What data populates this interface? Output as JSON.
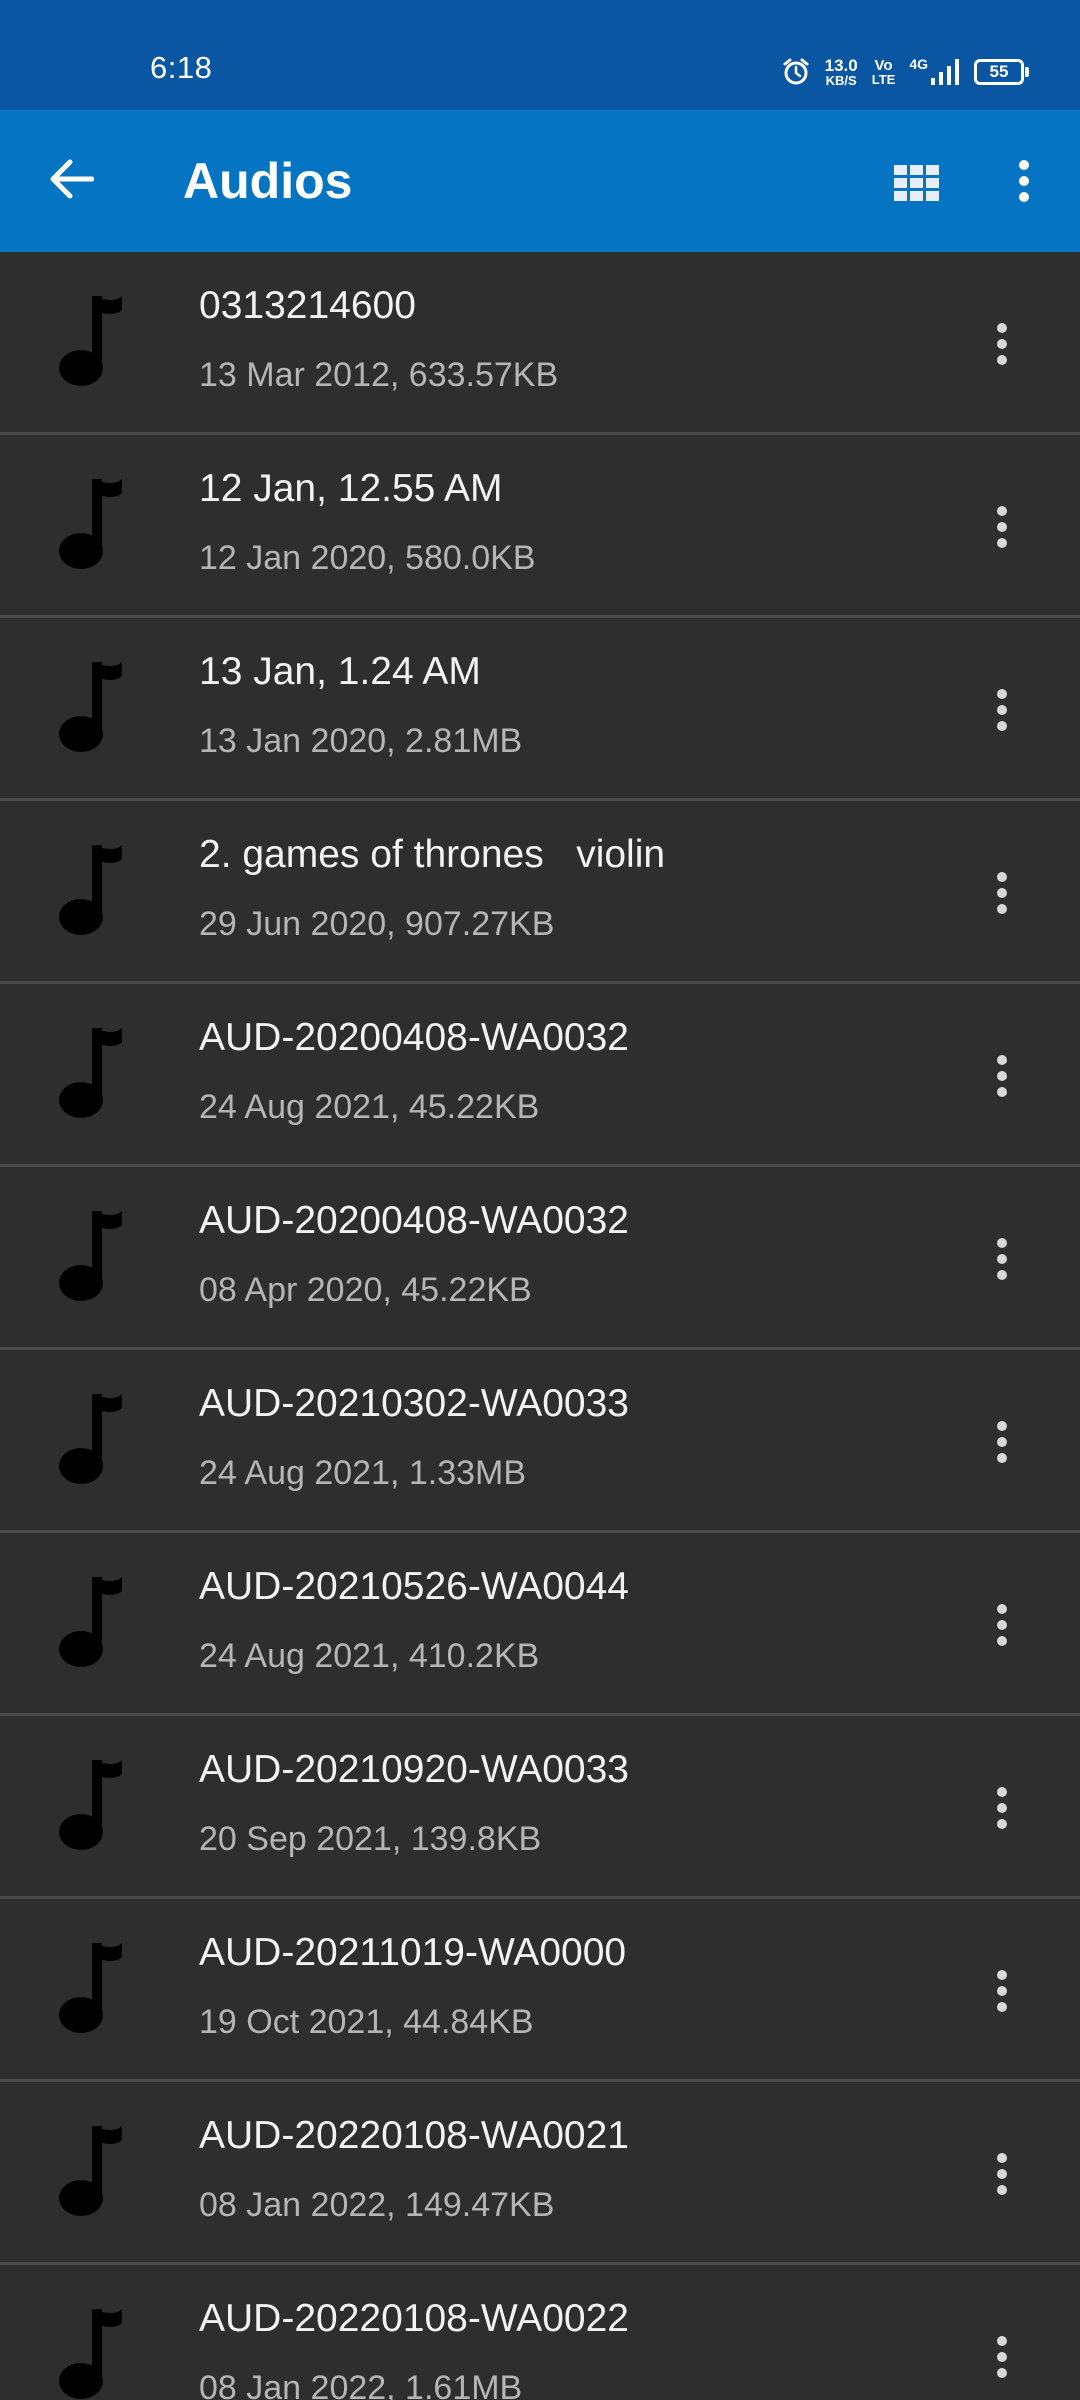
{
  "status_bar": {
    "time": "6:18",
    "net_speed_value": "13.0",
    "net_speed_unit": "KB/S",
    "volte_top": "Vo",
    "volte_bottom": "LTE",
    "network_type": "4G",
    "battery_level": "55",
    "icons": [
      "alarm-icon",
      "signal-icon",
      "battery-icon"
    ]
  },
  "app_bar": {
    "title": "Audios",
    "icons": [
      "back-arrow-icon",
      "grid-view-icon",
      "more-vert-icon"
    ],
    "background_color": "#0574c2"
  },
  "files": [
    {
      "name": "0313214600",
      "meta": "13 Mar 2012, 633.57KB"
    },
    {
      "name": "12 Jan, 12.55 AM",
      "meta": "12 Jan 2020, 580.0KB"
    },
    {
      "name": "13 Jan, 1.24 AM",
      "meta": "13 Jan 2020, 2.81MB"
    },
    {
      "name": "2. games of thrones   violin",
      "meta": "29 Jun 2020, 907.27KB"
    },
    {
      "name": "AUD-20200408-WA0032",
      "meta": "24 Aug 2021, 45.22KB"
    },
    {
      "name": "AUD-20200408-WA0032",
      "meta": "08 Apr 2020, 45.22KB"
    },
    {
      "name": "AUD-20210302-WA0033",
      "meta": "24 Aug 2021, 1.33MB"
    },
    {
      "name": "AUD-20210526-WA0044",
      "meta": "24 Aug 2021, 410.2KB"
    },
    {
      "name": "AUD-20210920-WA0033",
      "meta": "20 Sep 2021, 139.8KB"
    },
    {
      "name": "AUD-20211019-WA0000",
      "meta": "19 Oct 2021, 44.84KB"
    },
    {
      "name": "AUD-20220108-WA0021",
      "meta": "08 Jan 2022, 149.47KB"
    },
    {
      "name": "AUD-20220108-WA0022",
      "meta": "08 Jan 2022, 1.61MB"
    }
  ]
}
